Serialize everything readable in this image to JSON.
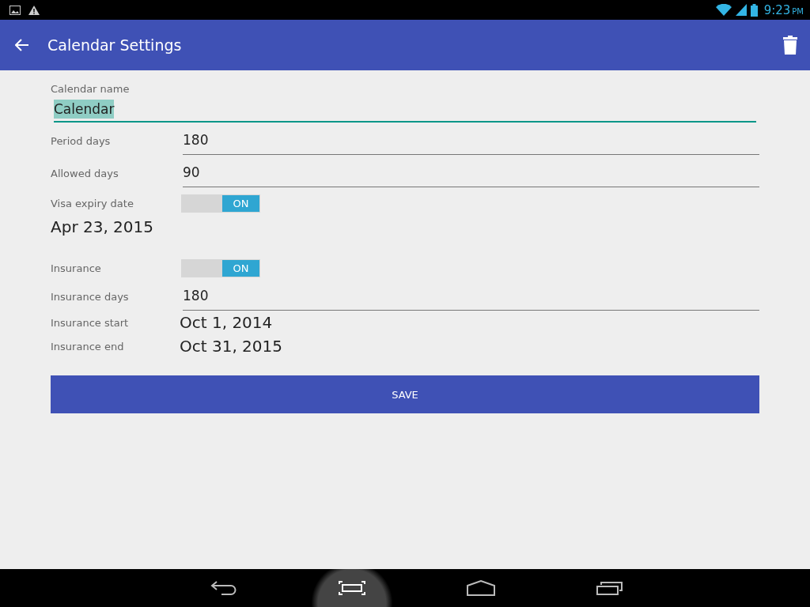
{
  "status_bar": {
    "time": "9:23",
    "ampm": "PM"
  },
  "app_bar": {
    "title": "Calendar Settings"
  },
  "name_field": {
    "label": "Calendar name",
    "value": "Calendar",
    "text_selected": true
  },
  "rows": [
    {
      "kind": "input",
      "label": "Period days",
      "value": "180"
    },
    {
      "kind": "input",
      "label": "Allowed days",
      "value": "90"
    },
    {
      "kind": "toggle",
      "label": "Visa expiry date",
      "on": true,
      "state_text": "ON"
    },
    {
      "kind": "date_block",
      "value": "Apr 23, 2015"
    },
    {
      "kind": "toggle",
      "label": "Insurance",
      "on": true,
      "state_text": "ON"
    },
    {
      "kind": "input",
      "label": "Insurance days",
      "value": "180"
    },
    {
      "kind": "date",
      "label": "Insurance start",
      "value": "Oct 1, 2014"
    },
    {
      "kind": "date",
      "label": "Insurance end",
      "value": "Oct 31, 2015"
    }
  ],
  "save_button": "SAVE"
}
